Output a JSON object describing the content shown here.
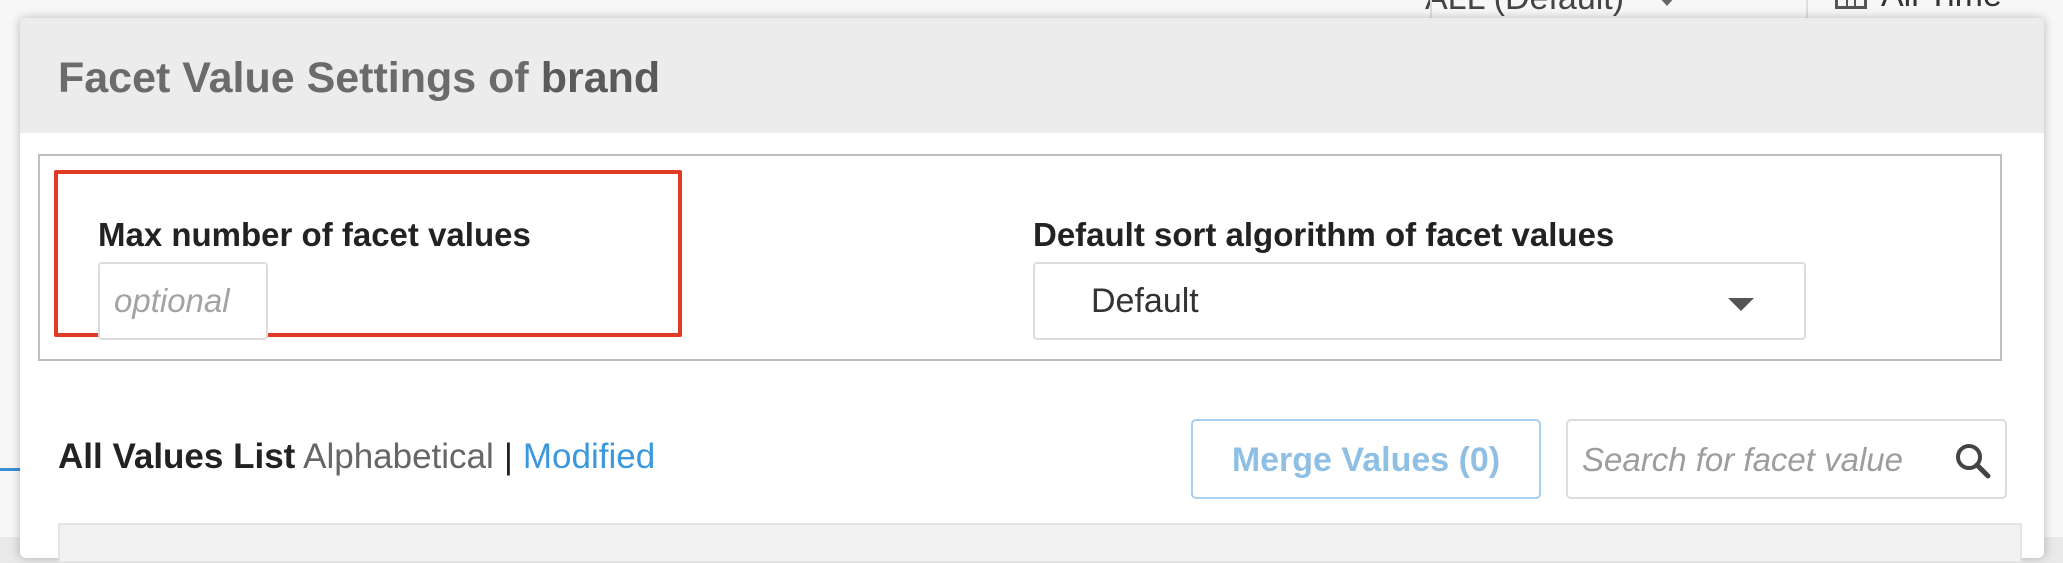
{
  "background": {
    "dropdown_value": "ALL (Default)",
    "time_label": "All Time"
  },
  "modal": {
    "title_prefix": "Facet Value Settings of",
    "title_field": "brand",
    "max_label": "Max number of facet values",
    "max_placeholder": "optional",
    "sort_label": "Default sort algorithm of facet values",
    "sort_value": "Default",
    "list_title": "All Values List",
    "sort_alphabetical": "Alphabetical",
    "sort_separator": "|",
    "sort_modified": "Modified",
    "merge_label": "Merge Values (0)",
    "search_placeholder": "Search for facet value"
  },
  "colors": {
    "highlight": "#e03b24",
    "link": "#3c98dc",
    "merge_disabled": "#90bfe4"
  }
}
